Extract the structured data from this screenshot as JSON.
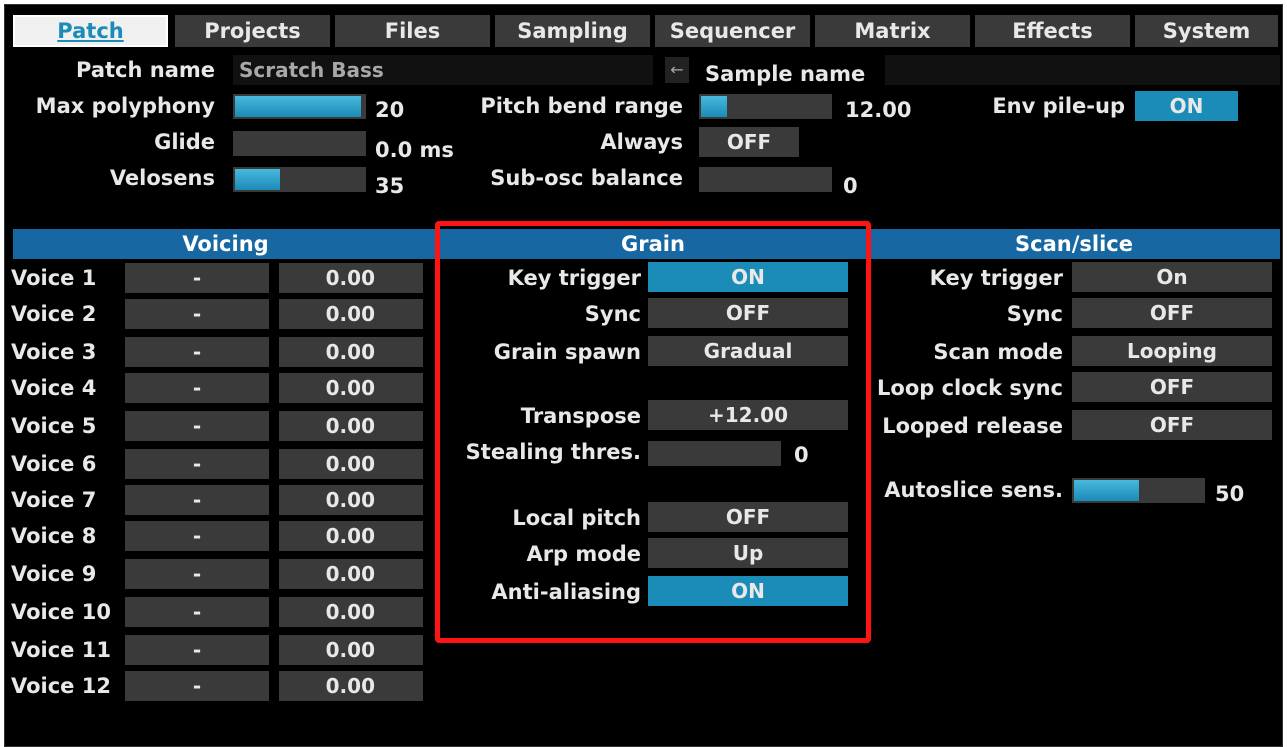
{
  "tabs": [
    "Patch",
    "Projects",
    "Files",
    "Sampling",
    "Sequencer",
    "Matrix",
    "Effects",
    "System"
  ],
  "top": {
    "patch_name_label": "Patch name",
    "patch_name_value": "Scratch Bass",
    "back_arrow": "←",
    "sample_name_label": "Sample name",
    "sample_name_value": "",
    "max_polyphony_label": "Max polyphony",
    "max_polyphony_value": "20",
    "max_polyphony_fraction": 0.98,
    "glide_label": "Glide",
    "glide_value": "0.0 ms",
    "glide_fraction": 0,
    "velosens_label": "Velosens",
    "velosens_value": "35",
    "velosens_fraction": 0.35,
    "pitch_bend_label": "Pitch bend range",
    "pitch_bend_value": "12.00",
    "pitch_bend_fraction": 0.2,
    "always_label": "Always",
    "always_value": "OFF",
    "sub_osc_label": "Sub-osc balance",
    "sub_osc_value": "0",
    "sub_osc_fraction": 0,
    "env_pileup_label": "Env pile-up",
    "env_pileup_value": "ON"
  },
  "voicing": {
    "title": "Voicing",
    "voices": [
      {
        "label": "Voice 1",
        "note": "-",
        "value": "0.00"
      },
      {
        "label": "Voice 2",
        "note": "-",
        "value": "0.00"
      },
      {
        "label": "Voice 3",
        "note": "-",
        "value": "0.00"
      },
      {
        "label": "Voice 4",
        "note": "-",
        "value": "0.00"
      },
      {
        "label": "Voice 5",
        "note": "-",
        "value": "0.00"
      },
      {
        "label": "Voice 6",
        "note": "-",
        "value": "0.00"
      },
      {
        "label": "Voice 7",
        "note": "-",
        "value": "0.00"
      },
      {
        "label": "Voice 8",
        "note": "-",
        "value": "0.00"
      },
      {
        "label": "Voice 9",
        "note": "-",
        "value": "0.00"
      },
      {
        "label": "Voice 10",
        "note": "-",
        "value": "0.00"
      },
      {
        "label": "Voice 11",
        "note": "-",
        "value": "0.00"
      },
      {
        "label": "Voice 12",
        "note": "-",
        "value": "0.00"
      }
    ]
  },
  "grain": {
    "title": "Grain",
    "key_trigger_label": "Key trigger",
    "key_trigger_value": "ON",
    "sync_label": "Sync",
    "sync_value": "OFF",
    "grain_spawn_label": "Grain spawn",
    "grain_spawn_value": "Gradual",
    "transpose_label": "Transpose",
    "transpose_value": "+12.00",
    "stealing_label": "Stealing thres.",
    "stealing_value": "0",
    "stealing_fraction": 0,
    "local_pitch_label": "Local pitch",
    "local_pitch_value": "OFF",
    "arp_mode_label": "Arp mode",
    "arp_mode_value": "Up",
    "anti_aliasing_label": "Anti-aliasing",
    "anti_aliasing_value": "ON"
  },
  "scan": {
    "title": "Scan/slice",
    "key_trigger_label": "Key trigger",
    "key_trigger_value": "On",
    "sync_label": "Sync",
    "sync_value": "OFF",
    "scan_mode_label": "Scan mode",
    "scan_mode_value": "Looping",
    "loop_clock_label": "Loop clock sync",
    "loop_clock_value": "OFF",
    "looped_release_label": "Looped release",
    "looped_release_value": "OFF",
    "autoslice_label": "Autoslice sens.",
    "autoslice_value": "50",
    "autoslice_fraction": 0.5
  },
  "colors": {
    "accent": "#1b8bb8",
    "header": "#1768a2",
    "control": "#3a3a3a",
    "highlight": "#ff1414"
  }
}
